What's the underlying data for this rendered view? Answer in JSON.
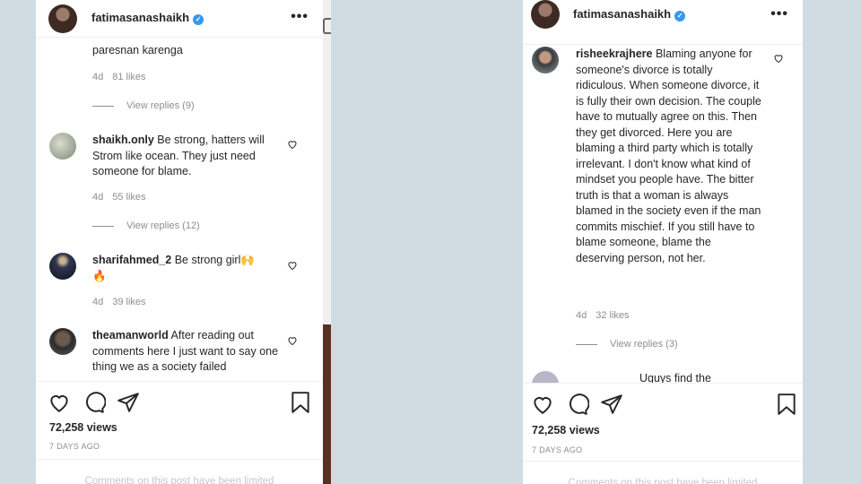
{
  "account": {
    "username": "fatimasanashaikh",
    "verified_mark": "✓",
    "more_label": "•••"
  },
  "left": {
    "top_fragment": "paresnan karenga",
    "top_meta": {
      "age": "4d",
      "likes": "81 likes"
    },
    "top_view_replies": "View replies (9)",
    "comments": [
      {
        "user": "shaikh.only",
        "text": "Be strong, hatters will Strom like ocean. They just need someone for blame.",
        "age": "4d",
        "likes": "55 likes",
        "view_replies": "View replies (12)"
      },
      {
        "user": "sharifahmed_2",
        "text": "Be strong girl🙌",
        "text2": "🔥",
        "age": "4d",
        "likes": "39 likes"
      },
      {
        "user": "theamanworld",
        "text": "After reading out comments here I just want to say one thing we as a society failed"
      }
    ],
    "views": "72,258 views",
    "posted": "7 DAYS AGO",
    "limited_note": "Comments on this post have been limited"
  },
  "right": {
    "comment": {
      "user": "risheekrajhere",
      "text": "Blaming anyone for someone's divorce is totally ridiculous. When someone divorce, it is fully their own decision. The couple have to mutually agree on this. Then they get divorced. Here you are blaming a third party which is totally irrelevant. I don't know what kind of mindset you people have. The bitter truth is that a woman is always blamed in the society even if the man commits mischief. If you still have to blame someone, blame the deserving person, not her.",
      "age": "4d",
      "likes": "32 likes",
      "view_replies": "View replies (3)"
    },
    "cut_off_text": "Uguys find the",
    "views": "72,258 views",
    "posted": "7 DAYS AGO",
    "limited_note": "Comments on this post have been limited"
  },
  "icons": {
    "like": "heart-icon",
    "comment": "comment-icon",
    "share": "send-icon",
    "save": "bookmark-icon",
    "comment_like": "small-heart-icon",
    "verified": "verified-badge-icon"
  },
  "colors": {
    "background": "#cfdde3",
    "verified": "#3897f0",
    "muted": "#8e8e8e",
    "text": "#262626"
  }
}
